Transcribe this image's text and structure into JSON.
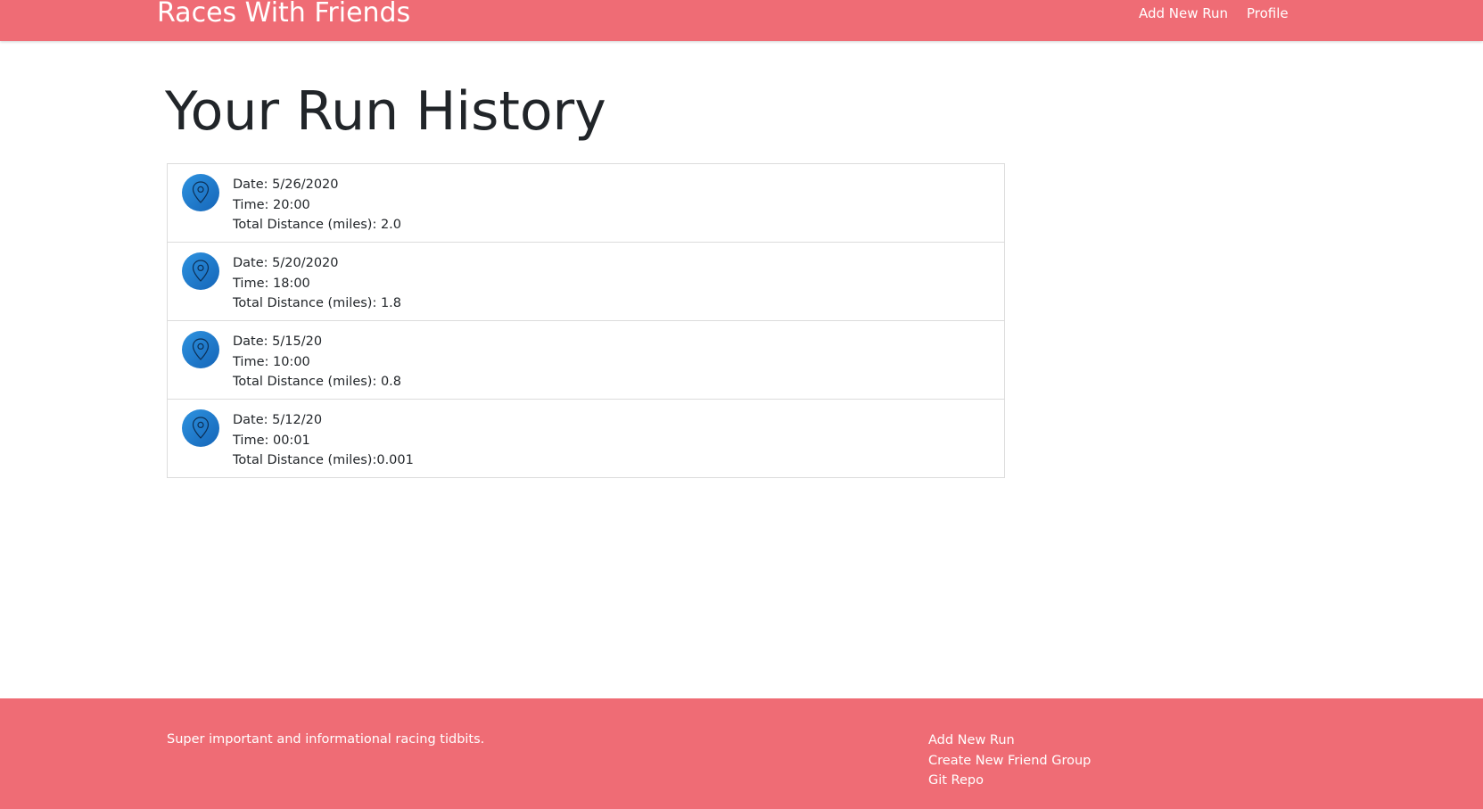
{
  "navbar": {
    "brand": "Races With Friends",
    "links": [
      "Add New Run",
      "Profile"
    ]
  },
  "main": {
    "title": "Your Run History",
    "runs": [
      {
        "date": "Date: 5/26/2020",
        "time": "Time: 20:00",
        "distance": "Total Distance (miles): 2.0"
      },
      {
        "date": "Date: 5/20/2020",
        "time": "Time: 18:00",
        "distance": "Total Distance (miles): 1.8"
      },
      {
        "date": "Date: 5/15/20",
        "time": "Time: 10:00",
        "distance": "Total Distance (miles): 0.8"
      },
      {
        "date": "Date: 5/12/20",
        "time": "Time: 00:01",
        "distance": "Total Distance (miles):0.001"
      }
    ],
    "run_icon": "map-pin-icon"
  },
  "footer": {
    "tagline": "Super important and informational racing tidbits.",
    "links": [
      "Add New Run",
      "Create New Friend Group",
      "Git Repo"
    ]
  },
  "colors": {
    "brand": "#ef6c75",
    "icon_blue": "#1f7fd0"
  }
}
